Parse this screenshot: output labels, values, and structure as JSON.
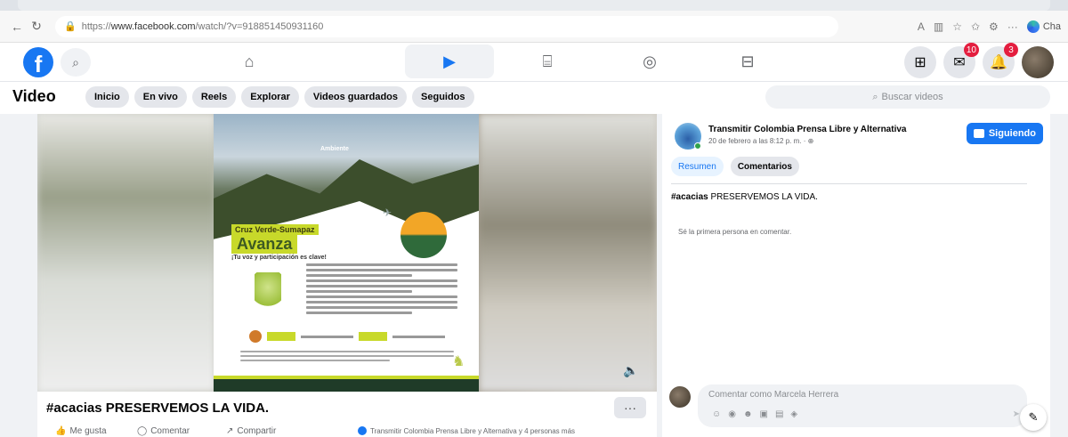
{
  "browser": {
    "url_prefix": "https://",
    "url_domain": "www.facebook.com",
    "url_path": "/watch/?v=918851450931160",
    "profile_label": "Cha"
  },
  "fb": {
    "logo": "f",
    "nav_tabs": [
      {
        "icon": "home-icon",
        "glyph": "⌂"
      },
      {
        "icon": "watch-icon",
        "glyph": "▶"
      },
      {
        "icon": "marketplace-icon",
        "glyph": "⌸"
      },
      {
        "icon": "groups-icon",
        "glyph": "◎"
      },
      {
        "icon": "gaming-icon",
        "glyph": "⊟"
      }
    ],
    "messenger_count": "10",
    "notifications_count": "3"
  },
  "video_nav": {
    "title": "Video",
    "chips": [
      "Inicio",
      "En vivo",
      "Reels",
      "Explorar",
      "Videos guardados",
      "Seguidos"
    ],
    "search_placeholder": "Buscar videos"
  },
  "poster": {
    "brand": "Ambiente",
    "headline_small": "Cruz Verde-Sumapaz",
    "headline_big": "Avanza",
    "subtitle": "¡Tu voz y participación es clave!"
  },
  "post": {
    "title": "#acacias PRESERVEMOS LA VIDA.",
    "more_label": "···",
    "actions": [
      "Me gusta",
      "Comentar",
      "Compartir"
    ],
    "reactions_text": "Transmitir Colombia Prensa Libre y Alternativa y 4 personas más"
  },
  "panel": {
    "page_name": "Transmitir Colombia Prensa Libre y Alternativa",
    "meta": "20 de febrero a las 8:12 p. m. · ",
    "follow_label": "Siguiendo",
    "tabs": [
      "Resumen",
      "Comentarios"
    ],
    "caption_tag": "#acacias",
    "caption_rest": " PRESERVEMOS LA VIDA.",
    "empty_comments": "Sé la primera persona en comentar.",
    "comment_placeholder": "Comentar como Marcela Herrera"
  }
}
